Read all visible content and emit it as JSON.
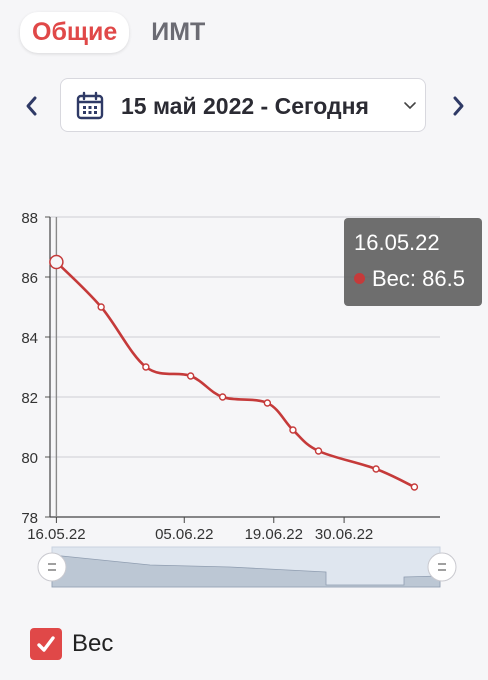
{
  "tabs": [
    {
      "label": "Общие",
      "active": true
    },
    {
      "label": "ИМТ",
      "active": false
    }
  ],
  "date_range": {
    "label": "15 май 2022 - Сегодня"
  },
  "colors": {
    "accent": "#e04848",
    "line": "#c53a3a",
    "tooltip_bg": "#626262",
    "slider_fill": "#dfe6ef"
  },
  "tooltip": {
    "date": "16.05.22",
    "value": "Вес: 86.5"
  },
  "legend": {
    "label": "Вес",
    "checked": true
  },
  "chart_data": {
    "type": "line",
    "title": "",
    "xlabel": "",
    "ylabel": "",
    "ylim": [
      78,
      88
    ],
    "y_ticks": [
      "78",
      "80",
      "82",
      "84",
      "86",
      "88"
    ],
    "x_tick_labels": [
      "16.05.22",
      "05.06.22",
      "19.06.22",
      "30.06.22"
    ],
    "grid": true,
    "series": [
      {
        "name": "Вес",
        "points": [
          {
            "x": "16.05.22",
            "y": 86.5
          },
          {
            "x": "23.05.22",
            "y": 85.0
          },
          {
            "x": "30.05.22",
            "y": 83.0
          },
          {
            "x": "06.06.22",
            "y": 82.7
          },
          {
            "x": "11.06.22",
            "y": 82.0
          },
          {
            "x": "18.06.22",
            "y": 81.8
          },
          {
            "x": "22.06.22",
            "y": 80.9
          },
          {
            "x": "26.06.22",
            "y": 80.2
          },
          {
            "x": "05.07.22",
            "y": 79.6
          },
          {
            "x": "11.07.22",
            "y": 79.0
          }
        ]
      }
    ],
    "highlighted": {
      "x": "16.05.22",
      "y": 86.5
    }
  }
}
